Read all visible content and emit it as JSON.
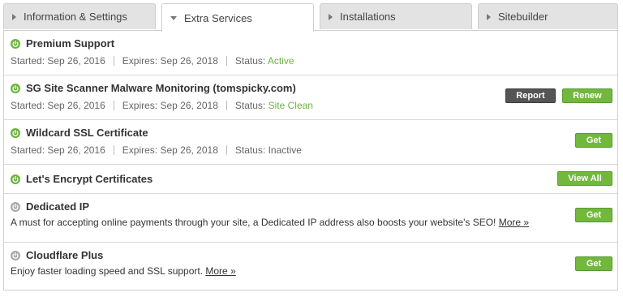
{
  "tabs": [
    {
      "label": "Information & Settings",
      "active": false
    },
    {
      "label": "Extra Services",
      "active": true
    },
    {
      "label": "Installations",
      "active": false
    },
    {
      "label": "Sitebuilder",
      "active": false
    }
  ],
  "colors": {
    "active_icon": "#6cb33f",
    "inactive_icon": "#aaaaaa",
    "status_ok": "#6cb33f",
    "button_green": "#72b83e",
    "button_dark": "#555555"
  },
  "services": [
    {
      "title": "Premium Support",
      "active": true,
      "started_label": "Started:",
      "started": "Sep 26, 2016",
      "expires_label": "Expires:",
      "expires": "Sep 26, 2018",
      "status_label": "Status:",
      "status": "Active"
    },
    {
      "title": "SG Site Scanner Malware Monitoring (tomspicky.com)",
      "active": true,
      "started_label": "Started:",
      "started": "Sep 26, 2016",
      "expires_label": "Expires:",
      "expires": "Sep 26, 2018",
      "status_label": "Status:",
      "status": "Site Clean",
      "report_label": "Report",
      "renew_label": "Renew"
    },
    {
      "title": "Wildcard SSL Certificate",
      "active": true,
      "started_label": "Started:",
      "started": "Sep 26, 2016",
      "expires_label": "Expires:",
      "expires": "Sep 26, 2018",
      "status_label": "Status:",
      "status": "Inactive",
      "get_label": "Get"
    },
    {
      "title": "Let's Encrypt Certificates",
      "active": true,
      "view_all_label": "View All"
    },
    {
      "title": "Dedicated IP",
      "active": false,
      "description": "A must for accepting online payments through your site, a Dedicated IP address also boosts your website's SEO!",
      "more_label": "More »",
      "get_label": "Get"
    },
    {
      "title": "Cloudflare Plus",
      "active": false,
      "description": "Enjoy faster loading speed and SSL support.",
      "more_label": "More »",
      "get_label": "Get"
    }
  ]
}
